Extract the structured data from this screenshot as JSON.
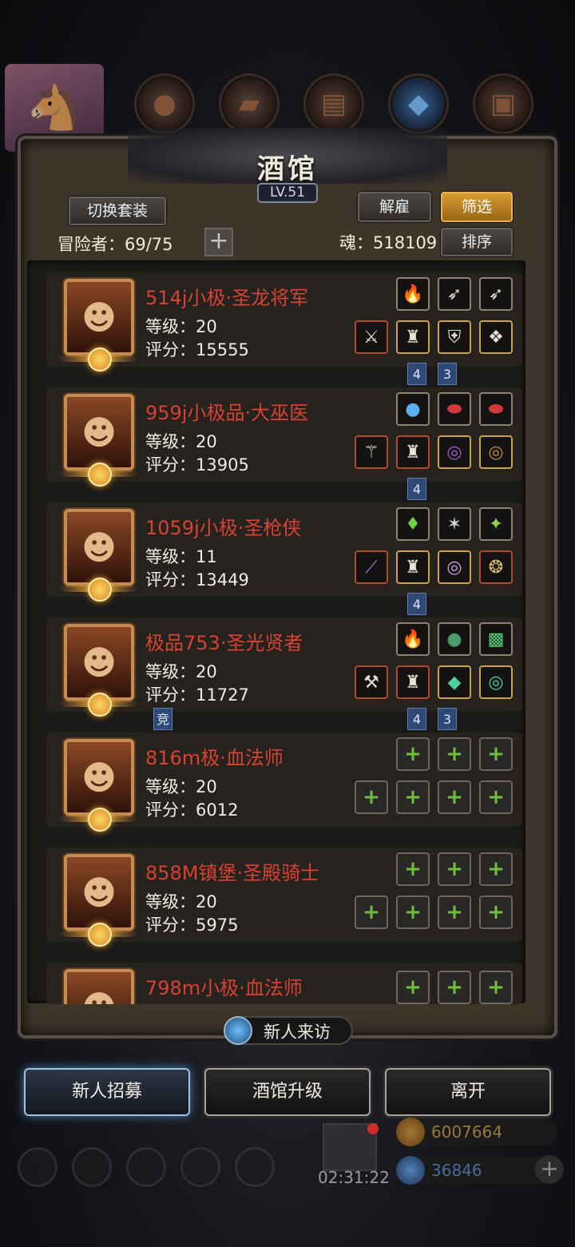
{
  "header": {
    "title": "酒馆",
    "level": "LV.51",
    "switch_set_label": "切换套装",
    "dismiss_label": "解雇",
    "filter_label": "筛选",
    "adventurers_label": "冒险者：69/75",
    "soul_label": "魂：518109",
    "sort_label": "排序",
    "add_icon": "plus-icon"
  },
  "heroes": [
    {
      "name": "514j小极·圣龙将军",
      "level": "等级：20",
      "score": "评分：15555",
      "tags": [
        "4",
        "3"
      ]
    },
    {
      "name": "959j小极品·大巫医",
      "level": "等级：20",
      "score": "评分：13905",
      "tags": [
        "4"
      ]
    },
    {
      "name": "1059j小极·圣枪侠",
      "level": "等级：11",
      "score": "评分：13449",
      "tags": [
        "4"
      ]
    },
    {
      "name": "极品753·圣光贤者",
      "level": "等级：20",
      "score": "评分：11727",
      "tags": [
        "4",
        "3"
      ],
      "badge": "竞"
    },
    {
      "name": "816m极·血法师",
      "level": "等级：20",
      "score": "评分：6012"
    },
    {
      "name": "858M镇堡·圣殿骑士",
      "level": "等级：20",
      "score": "评分：5975"
    },
    {
      "name": "798m小极·血法师"
    }
  ],
  "footer": {
    "new_visitor_label": "新人来访",
    "recruit_label": "新人招募",
    "upgrade_label": "酒馆升级",
    "leave_label": "离开",
    "timer": "02:31:22",
    "gold": "6007664",
    "gems": "36846"
  },
  "colors": {
    "hero_name": "#d74233",
    "accent_gold": "#d79d31",
    "tag_blue": "#2f4977"
  }
}
